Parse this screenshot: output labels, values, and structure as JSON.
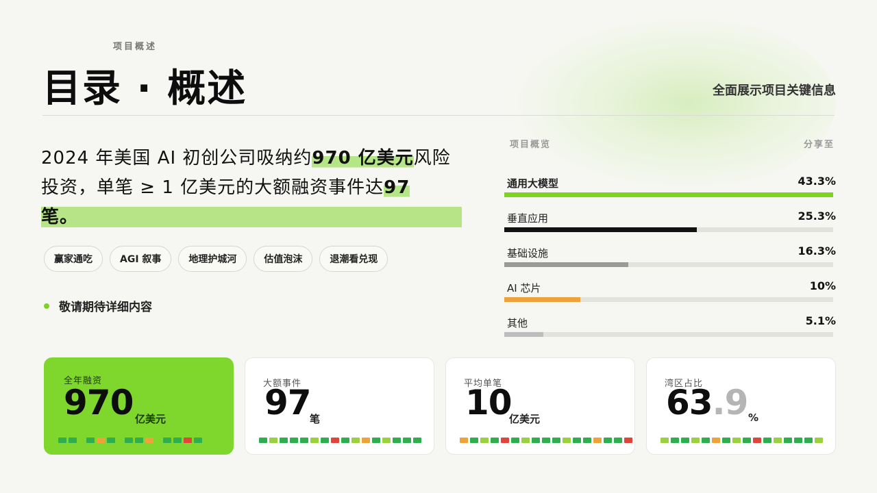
{
  "header": {
    "eyebrow": "项目概述",
    "title": "目录 · 概述",
    "tagline": "全面展示项目关键信息"
  },
  "headline": {
    "part1": "2024 年美国 AI 初创公司吸纳约",
    "highlight1": "970 亿美元",
    "part2": "风险投资，单笔 ≥ 1 亿美元的大额融资事件达",
    "highlight2": "97",
    "part3": "笔。"
  },
  "tags": [
    "赢家通吃",
    "AGI 叙事",
    "地理护城河",
    "估值泡沫",
    "退潮看兑现"
  ],
  "note": "敬请期待详细内容",
  "overview": {
    "title": "项目概览",
    "share_label": "分享至",
    "rows": [
      {
        "name": "通用大模型",
        "value": "43.3%",
        "fraction": 1.0,
        "color": "#7ed321",
        "bold": true
      },
      {
        "name": "垂直应用",
        "value": "25.3%",
        "fraction": 0.585,
        "color": "#111111",
        "bold": false
      },
      {
        "name": "基础设施",
        "value": "16.3%",
        "fraction": 0.377,
        "color": "#9a9b96",
        "bold": false
      },
      {
        "name": "AI 芯片",
        "value": "10%",
        "fraction": 0.231,
        "color": "#eea23a",
        "bold": false
      },
      {
        "name": "其他",
        "value": "5.1%",
        "fraction": 0.118,
        "color": "#bdbdbd",
        "bold": false
      }
    ]
  },
  "cards": [
    {
      "label": "全年融资",
      "number": "970",
      "decimal": "",
      "unit": "亿美元",
      "style": "green"
    },
    {
      "label": "大额事件",
      "number": "97",
      "decimal": "",
      "unit": "笔",
      "style": "white"
    },
    {
      "label": "平均单笔",
      "number": "10",
      "decimal": "",
      "unit": "亿美元",
      "style": "white"
    },
    {
      "label": "湾区占比",
      "number": "63",
      "decimal": ".9",
      "unit": "%",
      "style": "white"
    }
  ],
  "colors": {
    "accent": "#7ed321",
    "strip_green": "#2fae4f",
    "strip_lime": "#9bd13e",
    "strip_orange": "#eea23a",
    "strip_red": "#e0453a"
  }
}
